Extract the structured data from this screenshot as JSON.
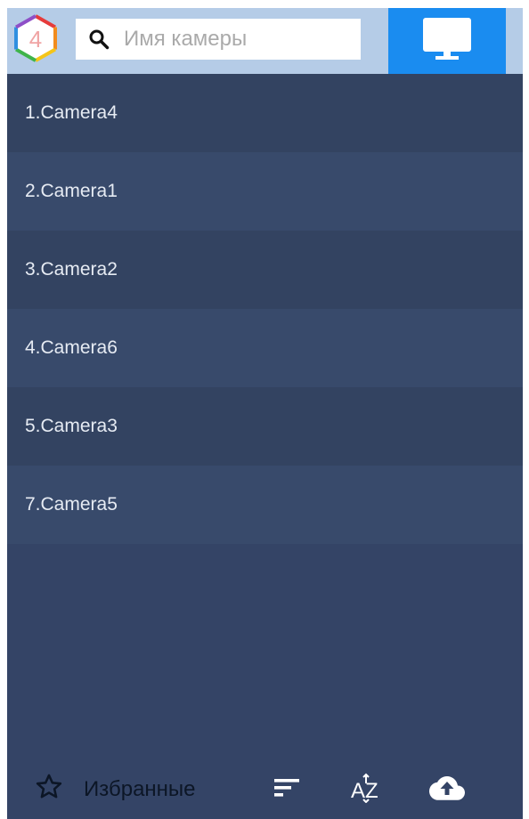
{
  "header": {
    "logo_digit": "4",
    "search": {
      "placeholder": "Имя камеры",
      "value": ""
    },
    "monitor_button_icon": "monitor-icon"
  },
  "cameras": [
    {
      "label": "1.Camera4"
    },
    {
      "label": "2.Camera1"
    },
    {
      "label": "3.Camera2"
    },
    {
      "label": "4.Camera6"
    },
    {
      "label": "5.Camera3"
    },
    {
      "label": "7.Camera5"
    }
  ],
  "footer": {
    "favorites_label": "Избранные",
    "favorites_icon": "star-outline-icon",
    "sort_icon": "sort-icon",
    "sort_az_icon": "sort-az-icon",
    "upload_icon": "cloud-upload-icon"
  },
  "colors": {
    "header_bg": "#b5cce7",
    "accent": "#1a8cf0",
    "list_bg": "#344466",
    "list_text": "#e6ebf3"
  }
}
